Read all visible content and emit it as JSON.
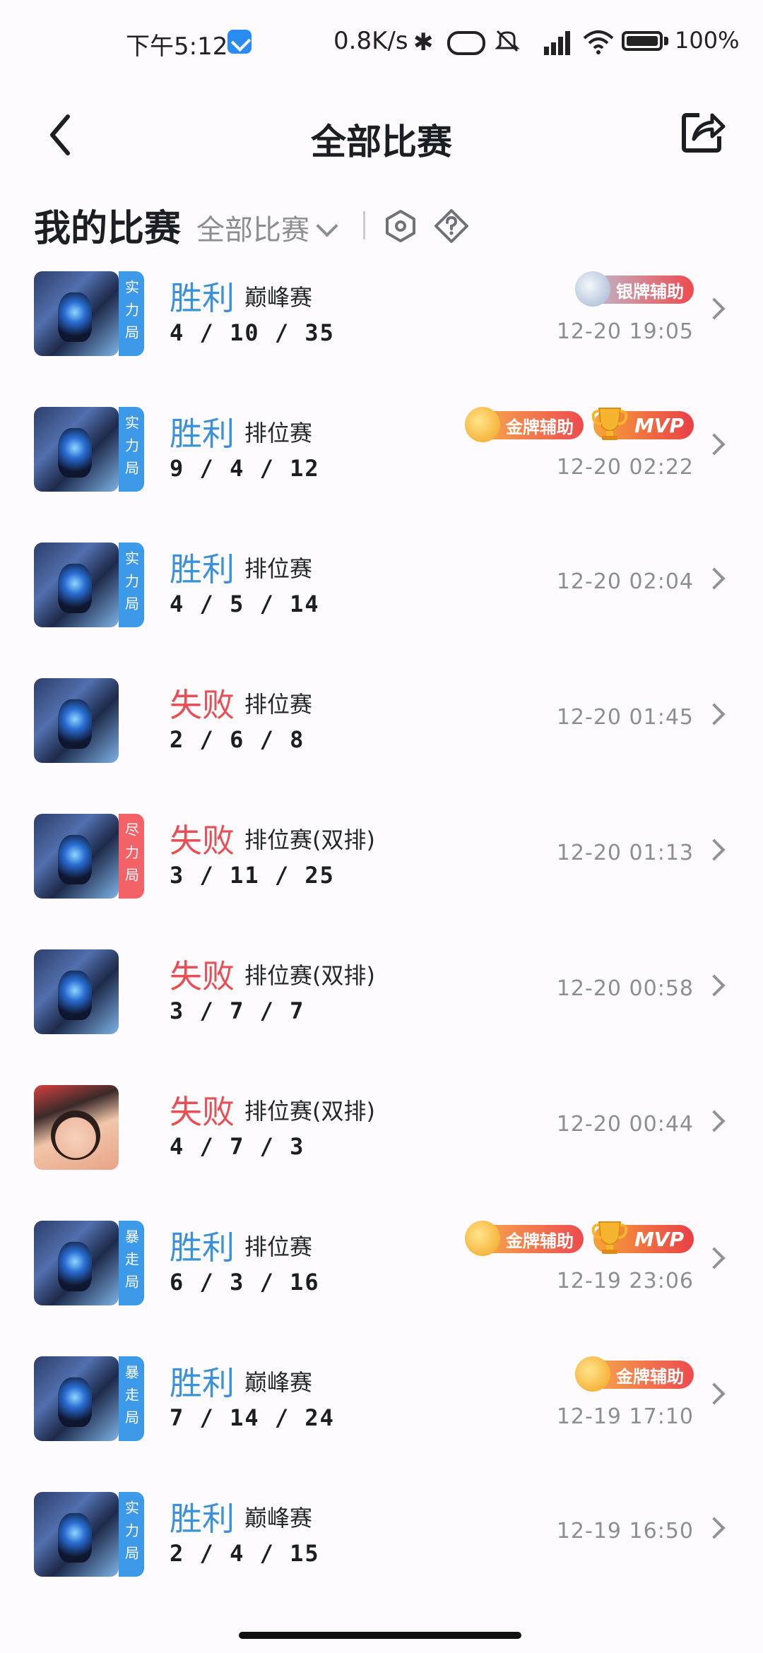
{
  "status_bar": {
    "time": "下午5:12",
    "net_speed": "0.8K/s",
    "battery": "100%",
    "icons": [
      "app-notification-icon",
      "bluetooth-icon",
      "nfc-icon",
      "mute-icon",
      "hd-signal-icon",
      "wifi-icon",
      "battery-icon"
    ]
  },
  "header": {
    "title": "全部比赛",
    "back_icon": "back-arrow-icon",
    "share_icon": "share-icon"
  },
  "filter": {
    "section_title": "我的比赛",
    "dropdown_label": "全部比赛",
    "icons": [
      "hexagon-settings-icon",
      "question-diamond-icon"
    ]
  },
  "matches": [
    {
      "result": "胜利",
      "outcome": "win",
      "mode": "巅峰赛",
      "kda": "4 / 10 / 35",
      "time": "12-20 19:05",
      "tag": "实力局",
      "tag_color": "blue",
      "avatar": "hero",
      "badges": [
        {
          "type": "silver",
          "label": "银牌辅助"
        }
      ]
    },
    {
      "result": "胜利",
      "outcome": "win",
      "mode": "排位赛",
      "kda": "9 / 4 / 12",
      "time": "12-20 02:22",
      "tag": "实力局",
      "tag_color": "blue",
      "avatar": "hero",
      "badges": [
        {
          "type": "gold",
          "label": "金牌辅助"
        },
        {
          "type": "mvp",
          "label": "MVP"
        }
      ]
    },
    {
      "result": "胜利",
      "outcome": "win",
      "mode": "排位赛",
      "kda": "4 / 5 / 14",
      "time": "12-20 02:04",
      "tag": "实力局",
      "tag_color": "blue",
      "avatar": "hero",
      "badges": []
    },
    {
      "result": "失败",
      "outcome": "lose",
      "mode": "排位赛",
      "kda": "2 / 6 / 8",
      "time": "12-20 01:45",
      "tag": "",
      "tag_color": "",
      "avatar": "hero",
      "badges": []
    },
    {
      "result": "失败",
      "outcome": "lose",
      "mode": "排位赛(双排)",
      "kda": "3 / 11 / 25",
      "time": "12-20 01:13",
      "tag": "尽力局",
      "tag_color": "red",
      "avatar": "hero",
      "badges": []
    },
    {
      "result": "失败",
      "outcome": "lose",
      "mode": "排位赛(双排)",
      "kda": "3 / 7 / 7",
      "time": "12-20 00:58",
      "tag": "",
      "tag_color": "",
      "avatar": "hero",
      "badges": []
    },
    {
      "result": "失败",
      "outcome": "lose",
      "mode": "排位赛(双排)",
      "kda": "4 / 7 / 3",
      "time": "12-20 00:44",
      "tag": "",
      "tag_color": "",
      "avatar": "girl",
      "badges": []
    },
    {
      "result": "胜利",
      "outcome": "win",
      "mode": "排位赛",
      "kda": "6 / 3 / 16",
      "time": "12-19 23:06",
      "tag": "暴走局",
      "tag_color": "blue",
      "avatar": "hero",
      "badges": [
        {
          "type": "gold",
          "label": "金牌辅助"
        },
        {
          "type": "mvp",
          "label": "MVP"
        }
      ]
    },
    {
      "result": "胜利",
      "outcome": "win",
      "mode": "巅峰赛",
      "kda": "7 / 14 / 24",
      "time": "12-19 17:10",
      "tag": "暴走局",
      "tag_color": "blue",
      "avatar": "hero",
      "badges": [
        {
          "type": "gold",
          "label": "金牌辅助"
        }
      ]
    },
    {
      "result": "胜利",
      "outcome": "win",
      "mode": "巅峰赛",
      "kda": "2 / 4 / 15",
      "time": "12-19 16:50",
      "tag": "实力局",
      "tag_color": "blue",
      "avatar": "hero",
      "badges": []
    }
  ]
}
